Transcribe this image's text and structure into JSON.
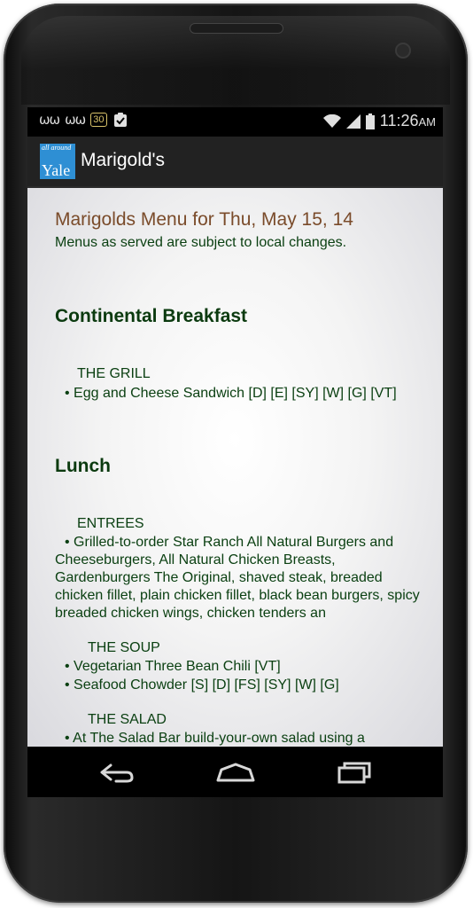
{
  "status_bar": {
    "voicemail_icons": [
      "voicemail-icon",
      "voicemail-icon"
    ],
    "badge": "30",
    "time": "11:26",
    "ampm": "AM"
  },
  "action_bar": {
    "logo_small": "all around",
    "logo_large": "Yale",
    "title": "Marigold's"
  },
  "content": {
    "menu_title": "Marigolds Menu for Thu, May 15, 14",
    "disclaimer": "Menus as served are subject to local changes.",
    "breakfast": {
      "meal": "Continental Breakfast",
      "station": "THE GRILL",
      "items": [
        "• Egg and Cheese Sandwich [D] [E] [SY] [W] [G] [VT]"
      ]
    },
    "lunch": {
      "meal": "Lunch",
      "entrees_station": "ENTREES",
      "entree_item": "• Grilled-to-order Star Ranch All Natural Burgers and Cheeseburgers, All Natural Chicken Breasts, Gardenburgers The Original, shaved steak, breaded chicken fillet, plain chicken fillet, black bean burgers, spicy breaded chicken wings, chicken tenders an",
      "soup_station": "THE SOUP",
      "soup_items": [
        "• Vegetarian Three Bean Chili [VT]",
        "• Seafood Chowder [S] [D] [FS] [SY] [W] [G]"
      ],
      "salad_station": "THE SALAD",
      "salad_item": "• At The Salad Bar build-your-own salad using a"
    }
  },
  "nav_bar": {
    "back": "back-icon",
    "home": "home-icon",
    "recents": "recent-apps-icon"
  },
  "colors": {
    "title_brown": "#7a4b2a",
    "text_green": "#0b4012",
    "logo_blue": "#2e8fd4"
  }
}
